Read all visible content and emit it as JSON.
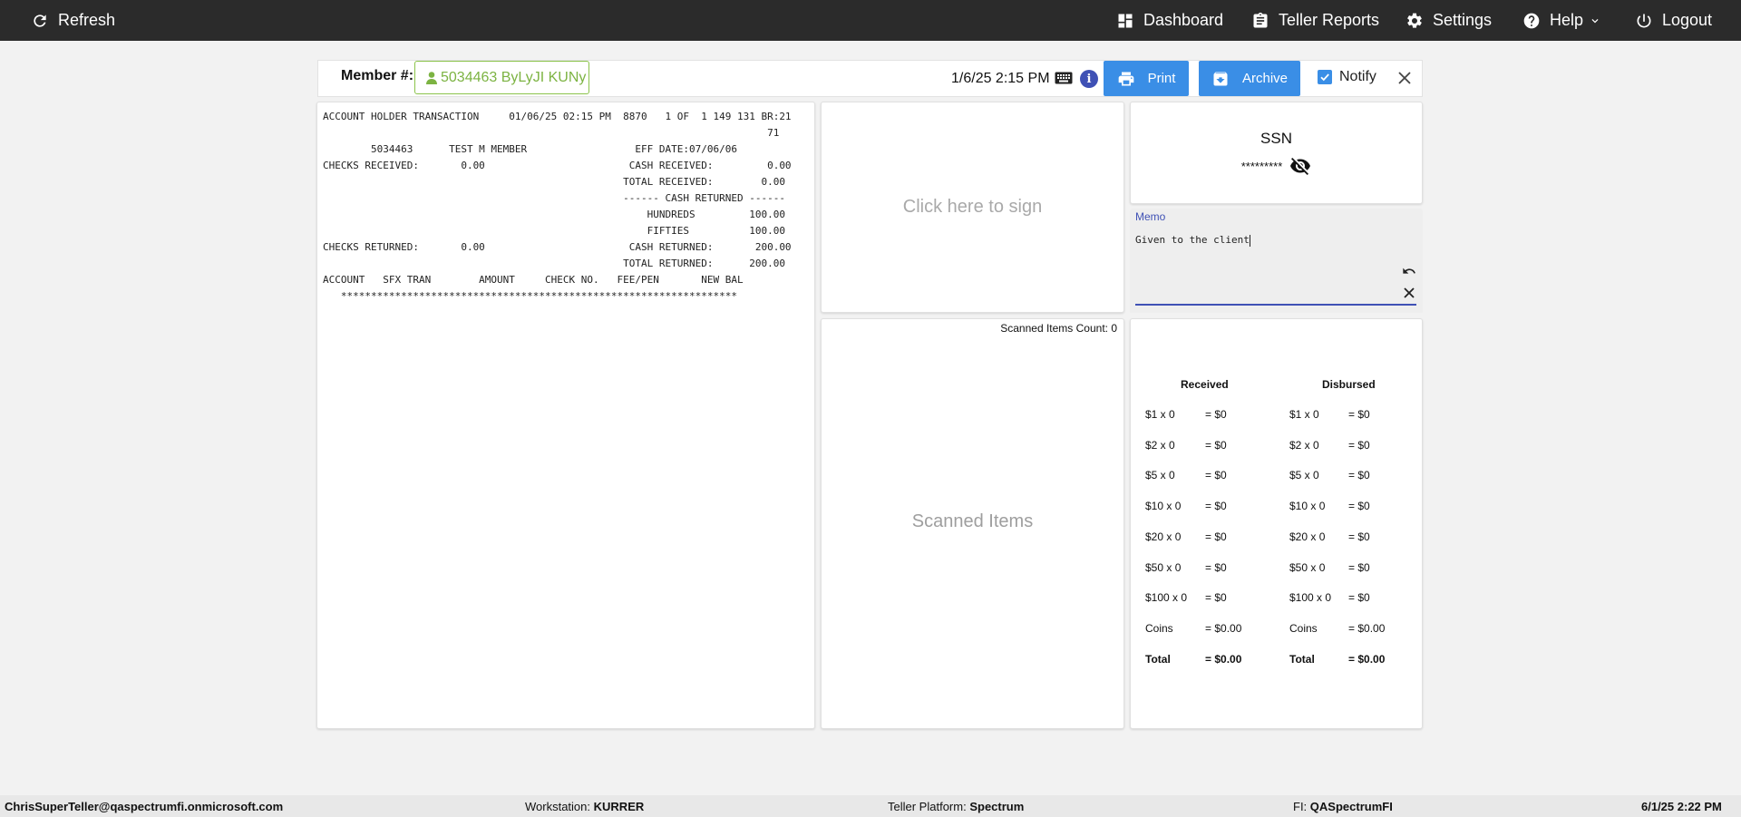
{
  "topbar": {
    "refresh": "Refresh",
    "dashboard": "Dashboard",
    "teller_reports": "Teller Reports",
    "settings": "Settings",
    "help": "Help",
    "logout": "Logout"
  },
  "header": {
    "member_label": "Member #:",
    "member_value": "5034463 ByLyJI KUNy",
    "datetime": "1/6/25 2:15 PM",
    "print": "Print",
    "archive": "Archive",
    "notify": "Notify",
    "notify_checked": true
  },
  "receipt": {
    "lines": [
      "ACCOUNT HOLDER TRANSACTION     01/06/25 02:15 PM  8870   1 OF  1 149 131 BR:21",
      "                                                                          71",
      "        5034463      TEST M MEMBER                  EFF DATE:07/06/06",
      "CHECKS RECEIVED:       0.00                        CASH RECEIVED:         0.00",
      "                                                  TOTAL RECEIVED:        0.00",
      "                                                  ------ CASH RETURNED ------",
      "                                                      HUNDREDS         100.00",
      "                                                      FIFTIES          100.00",
      "CHECKS RETURNED:       0.00                        CASH RETURNED:       200.00",
      "                                                  TOTAL RETURNED:      200.00",
      "ACCOUNT   SFX TRAN        AMOUNT     CHECK NO.   FEE/PEN       NEW BAL",
      "   ******************************************************************"
    ]
  },
  "signature": {
    "prompt": "Click here to sign"
  },
  "scanned": {
    "count_label": "Scanned Items Count: 0",
    "label": "Scanned Items"
  },
  "ssn": {
    "title": "SSN",
    "masked": "*********"
  },
  "memo": {
    "label": "Memo",
    "value": "Given to the client"
  },
  "cash": {
    "received_header": "Received",
    "disbursed_header": "Disbursed",
    "rows": [
      {
        "denom": "$1 x 0",
        "amount": "= $0"
      },
      {
        "denom": "$2 x 0",
        "amount": "= $0"
      },
      {
        "denom": "$5 x 0",
        "amount": "= $0"
      },
      {
        "denom": "$10 x 0",
        "amount": "= $0"
      },
      {
        "denom": "$20 x 0",
        "amount": "= $0"
      },
      {
        "denom": "$50 x 0",
        "amount": "= $0"
      },
      {
        "denom": "$100 x 0",
        "amount": "= $0"
      },
      {
        "denom": "Coins",
        "amount": "= $0.00"
      },
      {
        "denom": "Total",
        "amount": "= $0.00"
      }
    ],
    "disbursed_rows": [
      {
        "denom": "$1 x 0",
        "amount": "= $0"
      },
      {
        "denom": "$2 x 0",
        "amount": "= $0"
      },
      {
        "denom": "$5 x 0",
        "amount": "= $0"
      },
      {
        "denom": "$10 x 0",
        "amount": "= $0"
      },
      {
        "denom": "$20 x 0",
        "amount": "= $0"
      },
      {
        "denom": "$50 x 0",
        "amount": "= $0"
      },
      {
        "denom": "$100 x 0",
        "amount": "= $0"
      },
      {
        "denom": "Coins",
        "amount": "= $0.00"
      },
      {
        "denom": "Total",
        "amount": "= $0.00"
      }
    ]
  },
  "footer": {
    "user": "ChrisSuperTeller@qaspectrumfi.onmicrosoft.com",
    "workstation_label": "Workstation:",
    "workstation": "KURRER",
    "platform_label": "Teller Platform:",
    "platform": "Spectrum",
    "fi_label": "FI:",
    "fi": "QASpectrumFI",
    "datetime": "6/1/25 2:22 PM"
  },
  "colors": {
    "accent": "#3a8ee6",
    "member_green": "#7cb342",
    "memo_underline": "#3f51b5",
    "topbar": "#2b2b2b"
  }
}
